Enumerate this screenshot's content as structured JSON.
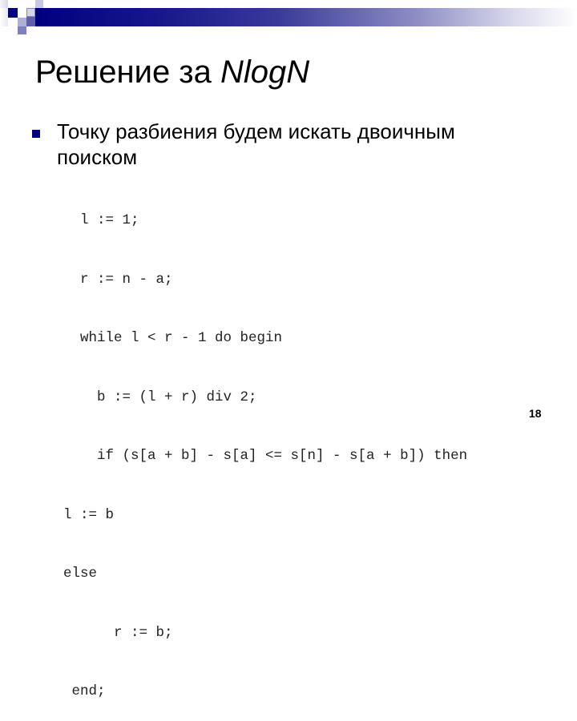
{
  "slide": {
    "title_plain": "Решение за ",
    "title_italic": "NlogN",
    "bullet_text": "Точку разбиения будем искать двоичным поиском",
    "code_lines": [
      "  l := 1;",
      "  r := n - a;",
      "  while l < r - 1 do begin",
      "    b := (l + r) div 2;",
      "    if (s[a + b] - s[a] <= s[n] - s[a + b]) then",
      "l := b",
      "else",
      "      r := b;",
      " end;"
    ],
    "page_number": "18",
    "colors": {
      "accent": "#000080"
    }
  }
}
